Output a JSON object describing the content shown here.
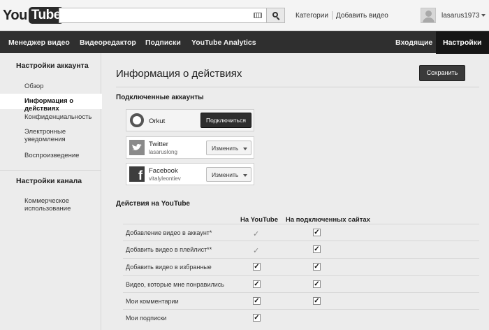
{
  "header": {
    "logo_you": "You",
    "logo_tube": "Tube",
    "search_placeholder": "",
    "links": [
      "Категории",
      "Добавить видео"
    ],
    "username": "lasarus1973"
  },
  "nav": {
    "items": [
      "Менеджер видео",
      "Видеоредактор",
      "Подписки",
      "YouTube Analytics"
    ],
    "inbox": "Входящие",
    "settings": "Настройки"
  },
  "sidebar": {
    "account_heading": "Настройки аккаунта",
    "account_items": [
      "Обзор",
      "Информация о действиях",
      "Конфиденциальность",
      "Электронные",
      "уведомления",
      "Воспроизведение"
    ],
    "channel_heading": "Настройки канала",
    "channel_items": [
      "Коммерческое",
      "использование"
    ],
    "active_item": "Информация о действиях"
  },
  "main": {
    "title": "Информация о действиях",
    "save_label": "Сохранить",
    "connected_heading": "Подключенные аккаунты",
    "accounts": [
      {
        "name": "Orkut",
        "sub": "",
        "button": "Подключиться",
        "icon": "orkut-icon"
      },
      {
        "name": "Twitter",
        "sub": "lasaruslong",
        "button": "Изменить",
        "icon": "twitter-icon"
      },
      {
        "name": "Facebook",
        "sub": "vitalyleontiev",
        "button": "Изменить",
        "icon": "facebook-icon"
      }
    ],
    "actions_heading": "Действия на YouTube",
    "col_youtube": "На YouTube",
    "col_sites": "На подключенных сайтах",
    "rows": [
      {
        "label": "Добавление видео в аккаунт*",
        "youtube": "tick",
        "sites": true
      },
      {
        "label": "Добавить видео в плейлист**",
        "youtube": "tick",
        "sites": true
      },
      {
        "label": "Добавить видео в избранные",
        "youtube": true,
        "sites": true
      },
      {
        "label": "Видео, которые мне понравились",
        "youtube": true,
        "sites": true
      },
      {
        "label": "Мои комментарии",
        "youtube": true,
        "sites": true
      },
      {
        "label": "Мои подписки",
        "youtube": true,
        "sites": null
      }
    ],
    "check_glyph": "✓"
  }
}
